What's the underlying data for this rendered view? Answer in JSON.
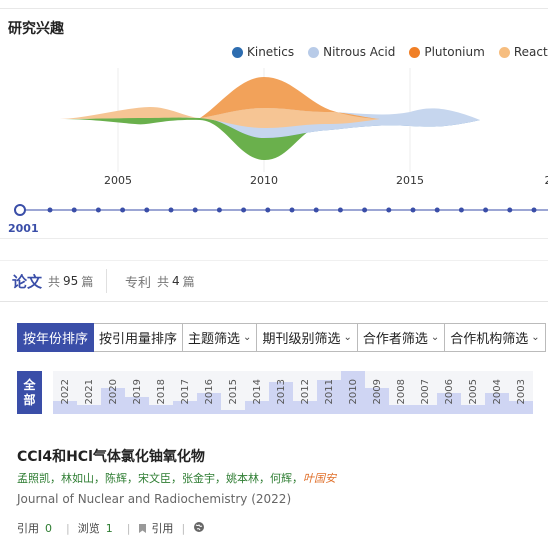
{
  "section_title": "研究兴趣",
  "legend": [
    {
      "label": "Kinetics",
      "color": "#2d6db0"
    },
    {
      "label": "Nitrous Acid",
      "color": "#b8cbe8"
    },
    {
      "label": "Plutonium",
      "color": "#f07f26"
    },
    {
      "label": "Reaction",
      "color": "#f6bd7f"
    }
  ],
  "chart_data": {
    "type": "area",
    "x_ticks": [
      "2005",
      "2010",
      "2015",
      "2"
    ],
    "extra_color": "#6ab04c"
  },
  "timeline": {
    "selected": "2001"
  },
  "tabs": {
    "papers": {
      "name": "论文",
      "prefix": "共",
      "count": "95",
      "suffix": "篇"
    },
    "patents": {
      "name": "专利",
      "prefix": "共",
      "count": "4",
      "suffix": "篇"
    }
  },
  "filters": [
    "按年份排序",
    "按引用量排序",
    "主题筛选",
    "期刊级别筛选",
    "合作者筛选",
    "合作机构筛选"
  ],
  "year_filter": {
    "all_label": [
      "全",
      "部"
    ],
    "years": [
      {
        "y": "2022",
        "level": 0.3
      },
      {
        "y": "2021",
        "level": 0.2
      },
      {
        "y": "2020",
        "level": 0.6
      },
      {
        "y": "2019",
        "level": 0.4
      },
      {
        "y": "2018",
        "level": 0.2
      },
      {
        "y": "2017",
        "level": 0.3
      },
      {
        "y": "2016",
        "level": 0.5
      },
      {
        "y": "2015",
        "level": 0.1
      },
      {
        "y": "2014",
        "level": 0.3
      },
      {
        "y": "2013",
        "level": 0.75
      },
      {
        "y": "2012",
        "level": 0.3
      },
      {
        "y": "2011",
        "level": 0.8
      },
      {
        "y": "2010",
        "level": 1.0
      },
      {
        "y": "2009",
        "level": 0.6
      },
      {
        "y": "2008",
        "level": 0.2
      },
      {
        "y": "2007",
        "level": 0.2
      },
      {
        "y": "2006",
        "level": 0.5
      },
      {
        "y": "2005",
        "level": 0.2
      },
      {
        "y": "2004",
        "level": 0.5
      },
      {
        "y": "2003",
        "level": 0.3
      }
    ]
  },
  "paper": {
    "title": "CCl4和HCl气体氯化铀氧化物",
    "authors": [
      "孟照凯",
      "林如山",
      "陈辉",
      "宋文臣",
      "张金宇",
      "姚本林",
      "何辉"
    ],
    "last_author": "叶国安",
    "journal": "Journal of Nuclear and Radiochemistry  (2022)",
    "cite_label": "引用",
    "cite_count": "0",
    "view_label": "浏览",
    "view_count": "1",
    "quote_label": "引用"
  }
}
